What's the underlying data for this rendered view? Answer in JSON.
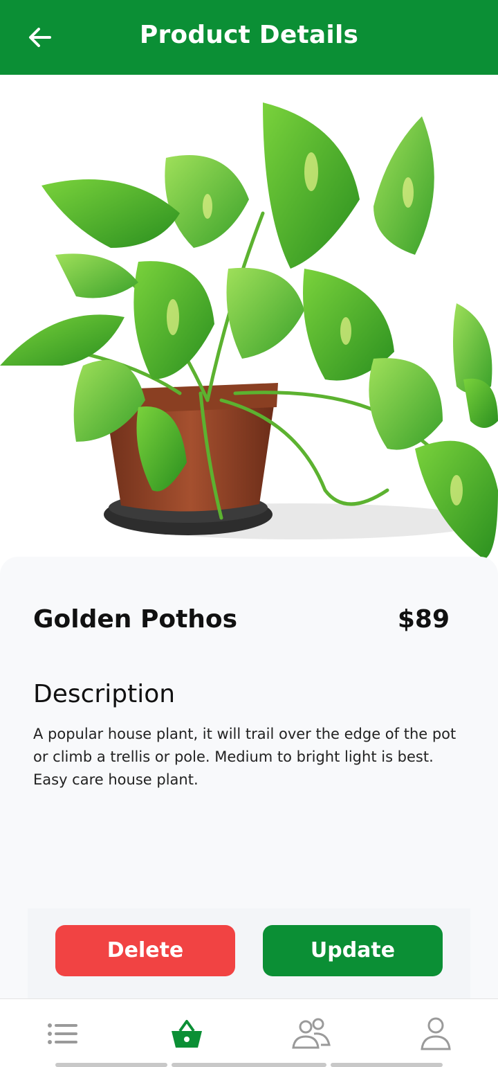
{
  "appbar": {
    "title": "Product Details",
    "back_icon": "arrow-left-icon",
    "background": "#0b8f35"
  },
  "product": {
    "name": "Golden Pothos",
    "price": "$89",
    "description_heading": "Description",
    "description": "A popular house plant, it will trail over the edge of the pot or climb a trellis or pole. Medium to bright light is best. Easy care house plant."
  },
  "actions": {
    "delete_label": "Delete",
    "update_label": "Update",
    "delete_color": "#f14343",
    "update_color": "#0b8f35"
  },
  "bottom_nav": {
    "items": [
      {
        "icon": "list-icon",
        "active": false
      },
      {
        "icon": "basket-icon",
        "active": true
      },
      {
        "icon": "users-icon",
        "active": false
      },
      {
        "icon": "profile-icon",
        "active": false
      }
    ],
    "active_color": "#0b8f35",
    "inactive_color": "#9a9a9a"
  }
}
